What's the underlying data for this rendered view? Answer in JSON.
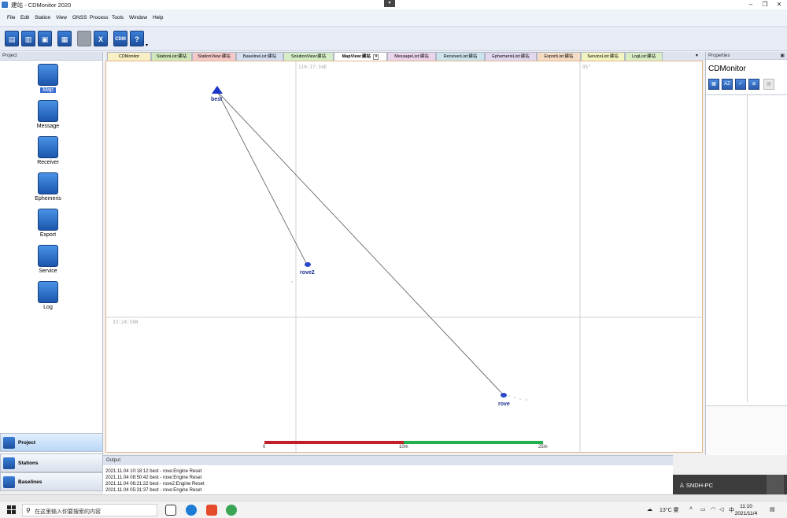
{
  "window": {
    "title": "建站 - CDMonitor 2020"
  },
  "menu": [
    "File",
    "Edit",
    "Station",
    "View",
    "GNSS",
    "Process",
    "Tools",
    "Window",
    "Help"
  ],
  "toolbar": {
    "cdm_label": "CDM",
    "close_glyph": "X",
    "help_glyph": "?"
  },
  "project": {
    "header": "Project",
    "items": [
      {
        "label": "Map",
        "icon": "globe-icon",
        "active": true
      },
      {
        "label": "Message",
        "icon": "waveform-icon"
      },
      {
        "label": "Receiver",
        "icon": "receiver-icon"
      },
      {
        "label": "Ephemeris",
        "icon": "crosshair-icon"
      },
      {
        "label": "Export",
        "icon": "export-icon"
      },
      {
        "label": "Service",
        "icon": "person-icon"
      },
      {
        "label": "Log",
        "icon": "notepad-icon"
      }
    ]
  },
  "nav": [
    {
      "label": "Project",
      "active": true
    },
    {
      "label": "Stations"
    },
    {
      "label": "Baselines"
    }
  ],
  "tabs": [
    {
      "label": "CDMonitor",
      "color": "#f9efc4"
    },
    {
      "label": "StationList:建站",
      "color": "#cfe7b9"
    },
    {
      "label": "StationView:建站",
      "color": "#f6c9c9"
    },
    {
      "label": "BaselineList:建站",
      "color": "#d6dff2"
    },
    {
      "label": "SolutionView:建站",
      "color": "#d4edc6"
    },
    {
      "label": "MapView:建站",
      "color": "#ffffff",
      "active": true
    },
    {
      "label": "MessageList:建站",
      "color": "#ecd4ec"
    },
    {
      "label": "ReceiverList:建站",
      "color": "#cde3ec"
    },
    {
      "label": "EphemerisList:建站",
      "color": "#e2d8ee"
    },
    {
      "label": "ExportList:建站",
      "color": "#f6dcc4"
    },
    {
      "label": "ServiceList:建站",
      "color": "#f4f4c0"
    },
    {
      "label": "LogList:建站",
      "color": "#d9ecc4"
    }
  ],
  "map": {
    "lon_label": "110:17:34E",
    "lon_label_right": "95\"",
    "lat_label": "33:24:58N",
    "stations": [
      {
        "name": "best",
        "type": "base"
      },
      {
        "name": "rove2",
        "type": "rover"
      },
      {
        "name": "rove",
        "type": "rover"
      }
    ],
    "scale": {
      "ticks": [
        "0",
        "10m",
        "25m"
      ],
      "colors": [
        "#c0202a",
        "#22b14c"
      ]
    }
  },
  "properties": {
    "header": "Properties",
    "title": "CDMonitor",
    "buttons": [
      "AZ",
      "▦",
      "✓",
      "⊕",
      "▤"
    ]
  },
  "output": {
    "header": "Output",
    "lines": [
      "2021.11.04 10:18:12 best - rove:Engine Reset",
      "2021.11.04 08:50:42 best - rove:Engine Reset",
      "2021.11.04 06:21:22 best - rove2:Engine Reset",
      "2021.11.04 05:31:37 best - rove:Engine Reset"
    ]
  },
  "user_popup": {
    "text": "SNDH-PC"
  },
  "taskbar": {
    "search_placeholder": "在这里输入你要搜索的内容",
    "weather": "13°C 雾",
    "ime": "中",
    "time": "11:10",
    "date": "2021/11/4"
  }
}
